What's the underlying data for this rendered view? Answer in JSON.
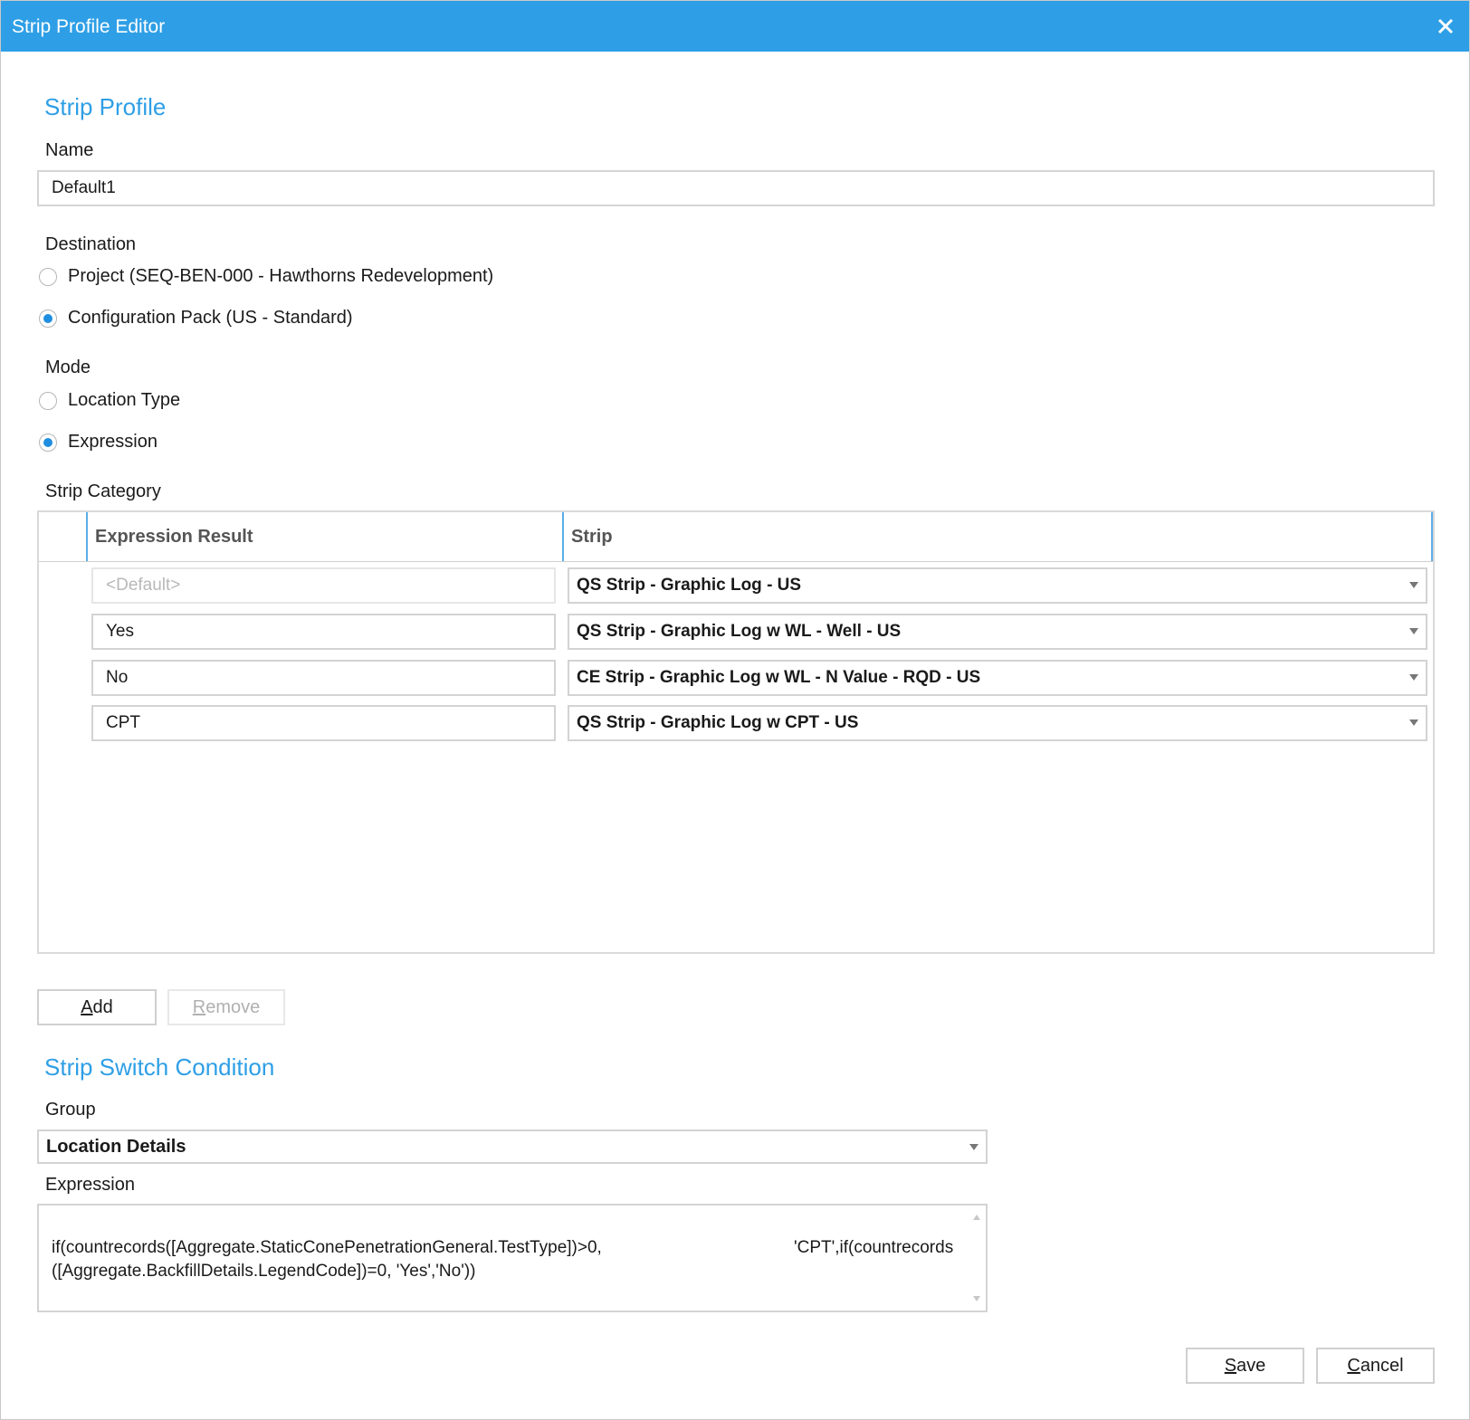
{
  "window": {
    "title": "Strip Profile Editor"
  },
  "strip_profile": {
    "section_title": "Strip Profile",
    "name_label": "Name",
    "name_value": "Default1",
    "destination_label": "Destination",
    "destination_options": [
      {
        "label": "Project (SEQ-BEN-000 - Hawthorns Redevelopment)",
        "checked": false
      },
      {
        "label": "Configuration Pack (US - Standard)",
        "checked": true
      }
    ],
    "mode_label": "Mode",
    "mode_options": [
      {
        "label": "Location Type",
        "checked": false
      },
      {
        "label": "Expression",
        "checked": true
      }
    ],
    "strip_category_label": "Strip Category"
  },
  "grid": {
    "columns": [
      "Expression Result",
      "Strip"
    ],
    "rows": [
      {
        "expression_result": "<Default>",
        "is_placeholder": true,
        "strip": "QS Strip - Graphic Log - US"
      },
      {
        "expression_result": "Yes",
        "is_placeholder": false,
        "strip": "QS Strip - Graphic Log w WL - Well - US"
      },
      {
        "expression_result": "No",
        "is_placeholder": false,
        "strip": "CE Strip - Graphic Log w WL - N Value - RQD - US"
      },
      {
        "expression_result": "CPT",
        "is_placeholder": false,
        "strip": "QS Strip - Graphic Log w CPT - US"
      }
    ]
  },
  "buttons": {
    "add": {
      "mnemonic": "A",
      "rest": "dd"
    },
    "remove": {
      "mnemonic": "R",
      "rest": "emove"
    },
    "save": {
      "mnemonic": "S",
      "rest": "ave"
    },
    "cancel": {
      "mnemonic": "C",
      "rest": "ancel"
    }
  },
  "switch_condition": {
    "section_title": "Strip Switch Condition",
    "group_label": "Group",
    "group_value": "Location Details",
    "expression_label": "Expression",
    "expression_line1_a": "if(countrecords([Aggregate.StaticConePenetrationGeneral.TestType])>0,",
    "expression_line1_b": "'CPT',if(countrecords",
    "expression_line2": "([Aggregate.BackfillDetails.LegendCode])=0, 'Yes','No'))"
  },
  "colors": {
    "accent": "#2e9fe6",
    "radio_checked": "#1f8ee0"
  }
}
